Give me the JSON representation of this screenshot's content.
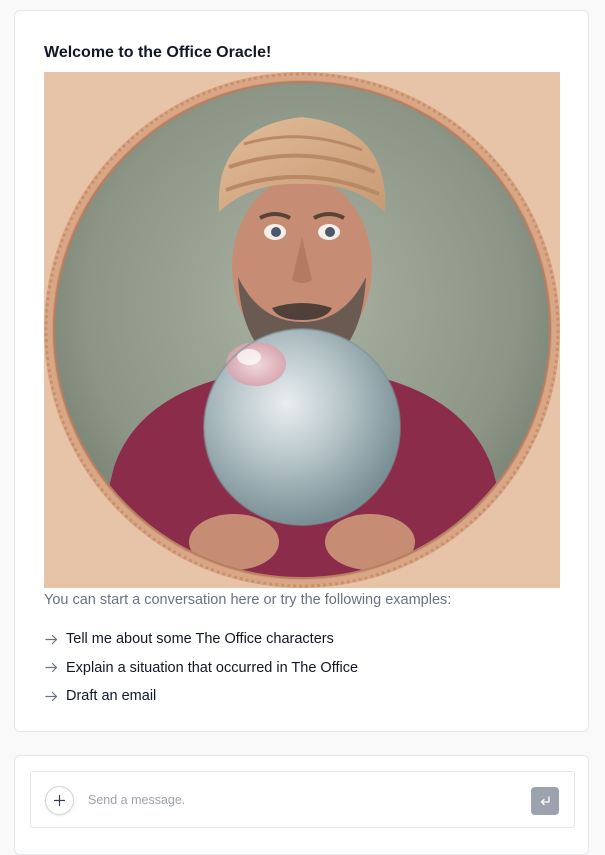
{
  "welcome": {
    "title": "Welcome to the Office Oracle!",
    "intro": "You can start a conversation here or try the following examples:",
    "examples": [
      "Tell me about some The Office characters",
      "Explain a situation that occurred in The Office",
      "Draft an email"
    ]
  },
  "composer": {
    "placeholder": "Send a message.",
    "value": ""
  },
  "icons": {
    "example": "arrow-right-icon",
    "add": "plus-icon",
    "send": "enter-return-icon"
  },
  "colors": {
    "card_border": "#e5e7eb",
    "muted_text": "#6b7280",
    "send_button": "#9ca3af",
    "turban": "#d4a882",
    "jacket": "#8b2c4a"
  }
}
